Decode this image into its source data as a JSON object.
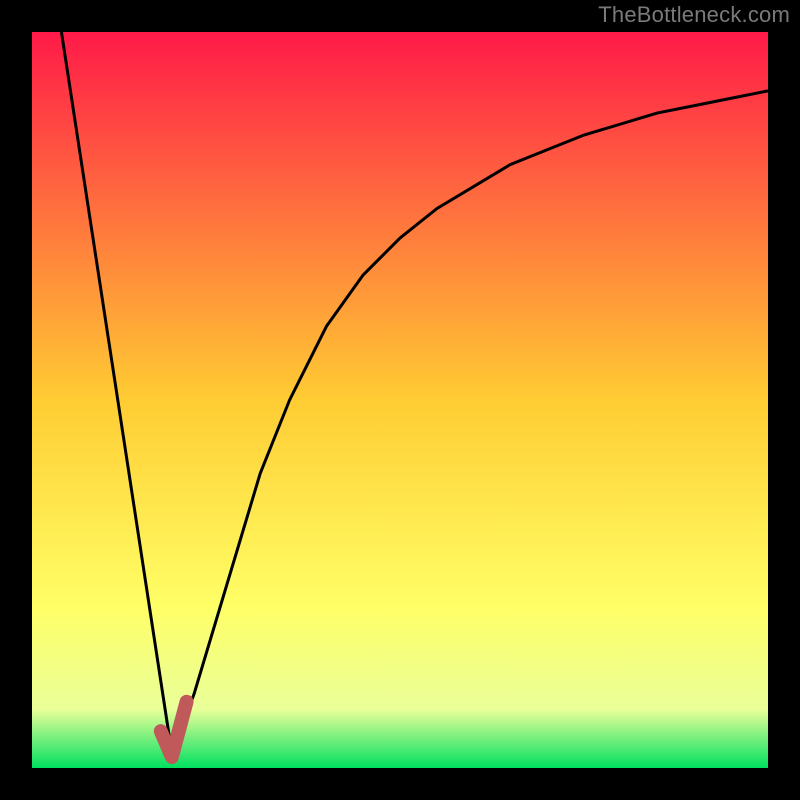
{
  "watermark": "TheBottleneck.com",
  "chart_data": {
    "type": "line",
    "title": "",
    "xlabel": "",
    "ylabel": "",
    "xlim": [
      0,
      100
    ],
    "ylim": [
      0,
      100
    ],
    "grid": false,
    "legend": false,
    "gradient_stops": [
      {
        "offset": 0,
        "color": "#ff1a48"
      },
      {
        "offset": 50,
        "color": "#ffcc33"
      },
      {
        "offset": 78,
        "color": "#ffff66"
      },
      {
        "offset": 92,
        "color": "#eaff99"
      },
      {
        "offset": 100,
        "color": "#00e060"
      }
    ],
    "frame_color": "#000000",
    "frame_thickness_px": 32,
    "series": [
      {
        "name": "left_line",
        "stroke": "#000000",
        "width": 3,
        "x": [
          4,
          19
        ],
        "y": [
          100,
          2
        ]
      },
      {
        "name": "right_curve",
        "stroke": "#000000",
        "width": 3,
        "x": [
          19,
          22,
          25,
          28,
          31,
          35,
          40,
          45,
          50,
          55,
          60,
          65,
          70,
          75,
          80,
          85,
          90,
          95,
          100
        ],
        "y": [
          2,
          10,
          20,
          30,
          40,
          50,
          60,
          67,
          72,
          76,
          79,
          82,
          84,
          86,
          87.5,
          89,
          90,
          91,
          92
        ]
      },
      {
        "name": "marker_hook",
        "stroke": "#c05a5a",
        "width": 14,
        "linecap": "round",
        "x": [
          17.5,
          19,
          21
        ],
        "y": [
          5,
          1.5,
          9
        ]
      }
    ]
  }
}
